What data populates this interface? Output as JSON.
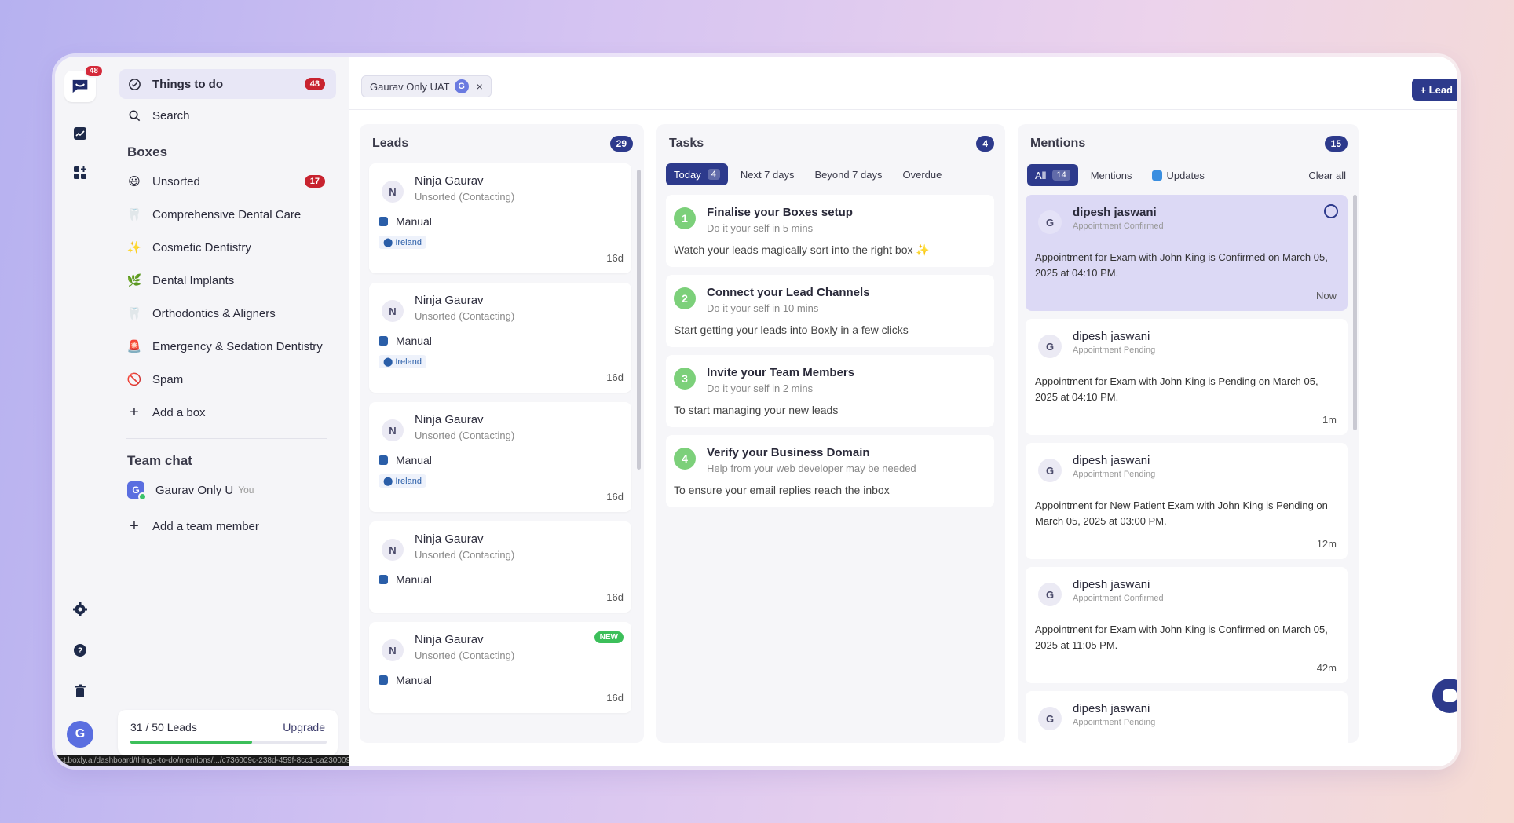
{
  "rail": {
    "notification_count": "48",
    "avatar_initial": "G",
    "icons": [
      "boxly-logo-icon",
      "chart-line-icon",
      "apps-grid-icon",
      "gear-icon",
      "help-icon",
      "trash-icon"
    ]
  },
  "sidebar": {
    "things_to_do": {
      "label": "Things to do",
      "count": "48"
    },
    "search_label": "Search",
    "boxes_title": "Boxes",
    "boxes": [
      {
        "label": "Unsorted",
        "emoji": "😃",
        "count": "17"
      },
      {
        "label": "Comprehensive Dental Care",
        "emoji": "🦷"
      },
      {
        "label": "Cosmetic Dentistry",
        "emoji": "✨"
      },
      {
        "label": "Dental Implants",
        "emoji": "🌿"
      },
      {
        "label": "Orthodontics & Aligners",
        "emoji": "🦷"
      },
      {
        "label": "Emergency & Sedation Dentistry",
        "emoji": "🚨"
      },
      {
        "label": "Spam",
        "emoji": "🚫"
      }
    ],
    "add_box": "Add a box",
    "team_title": "Team chat",
    "team_member": {
      "initial": "G",
      "name": "Gaurav Only U",
      "you": "You"
    },
    "add_member": "Add a team member",
    "leads_usage": "31 / 50 Leads",
    "leads_fraction": 0.62,
    "upgrade": "Upgrade",
    "status_url": "ct.boxly.ai/dashboard/things-to-do/mentions/.../c736009c-238d-459f-8cc1-ca2300097800"
  },
  "topbar": {
    "filter_chip": "Gaurav Only UAT",
    "filter_initial": "G",
    "filter_remove": "×",
    "lead_button": "+ Lead"
  },
  "leads": {
    "title": "Leads",
    "count": "29",
    "items": [
      {
        "initial": "N",
        "name": "Ninja Gaurav",
        "status": "Unsorted (Contacting)",
        "source": "Manual",
        "location": "Ireland",
        "age": "16d"
      },
      {
        "initial": "N",
        "name": "Ninja Gaurav",
        "status": "Unsorted (Contacting)",
        "source": "Manual",
        "location": "Ireland",
        "age": "16d"
      },
      {
        "initial": "N",
        "name": "Ninja Gaurav",
        "status": "Unsorted (Contacting)",
        "source": "Manual",
        "location": "Ireland",
        "age": "16d"
      },
      {
        "initial": "N",
        "name": "Ninja Gaurav",
        "status": "Unsorted (Contacting)",
        "source": "Manual",
        "age": "16d"
      },
      {
        "initial": "N",
        "name": "Ninja Gaurav",
        "status": "Unsorted (Contacting)",
        "source": "Manual",
        "age": "16d",
        "badge": "NEW"
      }
    ]
  },
  "tasks": {
    "title": "Tasks",
    "count": "4",
    "tabs": [
      {
        "label": "Today",
        "count": "4"
      },
      {
        "label": "Next 7 days"
      },
      {
        "label": "Beyond 7 days"
      },
      {
        "label": "Overdue"
      }
    ],
    "items": [
      {
        "num": "1",
        "title": "Finalise your Boxes setup",
        "sub": "Do it your self in 5 mins",
        "desc": "Watch your leads magically sort into the right box ✨"
      },
      {
        "num": "2",
        "title": "Connect your Lead Channels",
        "sub": "Do it your self in 10 mins",
        "desc": "Start getting your leads into Boxly in a few clicks"
      },
      {
        "num": "3",
        "title": "Invite your Team Members",
        "sub": "Do it your self in 2 mins",
        "desc": "To start managing your new leads"
      },
      {
        "num": "4",
        "title": "Verify your Business Domain",
        "sub": "Help from your web developer may be needed",
        "desc": "To ensure your email replies reach the inbox"
      }
    ]
  },
  "mentions": {
    "title": "Mentions",
    "count": "15",
    "tabs": [
      {
        "label": "All",
        "count": "14"
      },
      {
        "label": "Mentions"
      },
      {
        "label": "Updates"
      }
    ],
    "clear_all": "Clear all",
    "items": [
      {
        "initial": "G",
        "name": "dipesh jaswani",
        "sub": "Appointment Confirmed",
        "body": "Appointment for Exam with John King is Confirmed on March 05, 2025 at 04:10 PM.",
        "time": "Now"
      },
      {
        "initial": "G",
        "name": "dipesh jaswani",
        "sub": "Appointment Pending",
        "body": "Appointment for Exam with John King is Pending on March 05, 2025 at 04:10 PM.",
        "time": "1m"
      },
      {
        "initial": "G",
        "name": "dipesh jaswani",
        "sub": "Appointment Pending",
        "body": "Appointment for New Patient Exam with John King is Pending on March 05, 2025 at 03:00 PM.",
        "time": "12m"
      },
      {
        "initial": "G",
        "name": "dipesh jaswani",
        "sub": "Appointment Confirmed",
        "body": "Appointment for Exam with John King is Confirmed on March 05, 2025 at 11:05 PM.",
        "time": "42m"
      },
      {
        "initial": "G",
        "name": "dipesh jaswani",
        "sub": "Appointment Pending",
        "body": "",
        "time": ""
      }
    ]
  },
  "colors": {
    "accent_navy": "#2d3a8c",
    "badge_red": "#c8232f",
    "success_green": "#3cbf5a",
    "highlight_lavender": "#dcd9f5"
  }
}
